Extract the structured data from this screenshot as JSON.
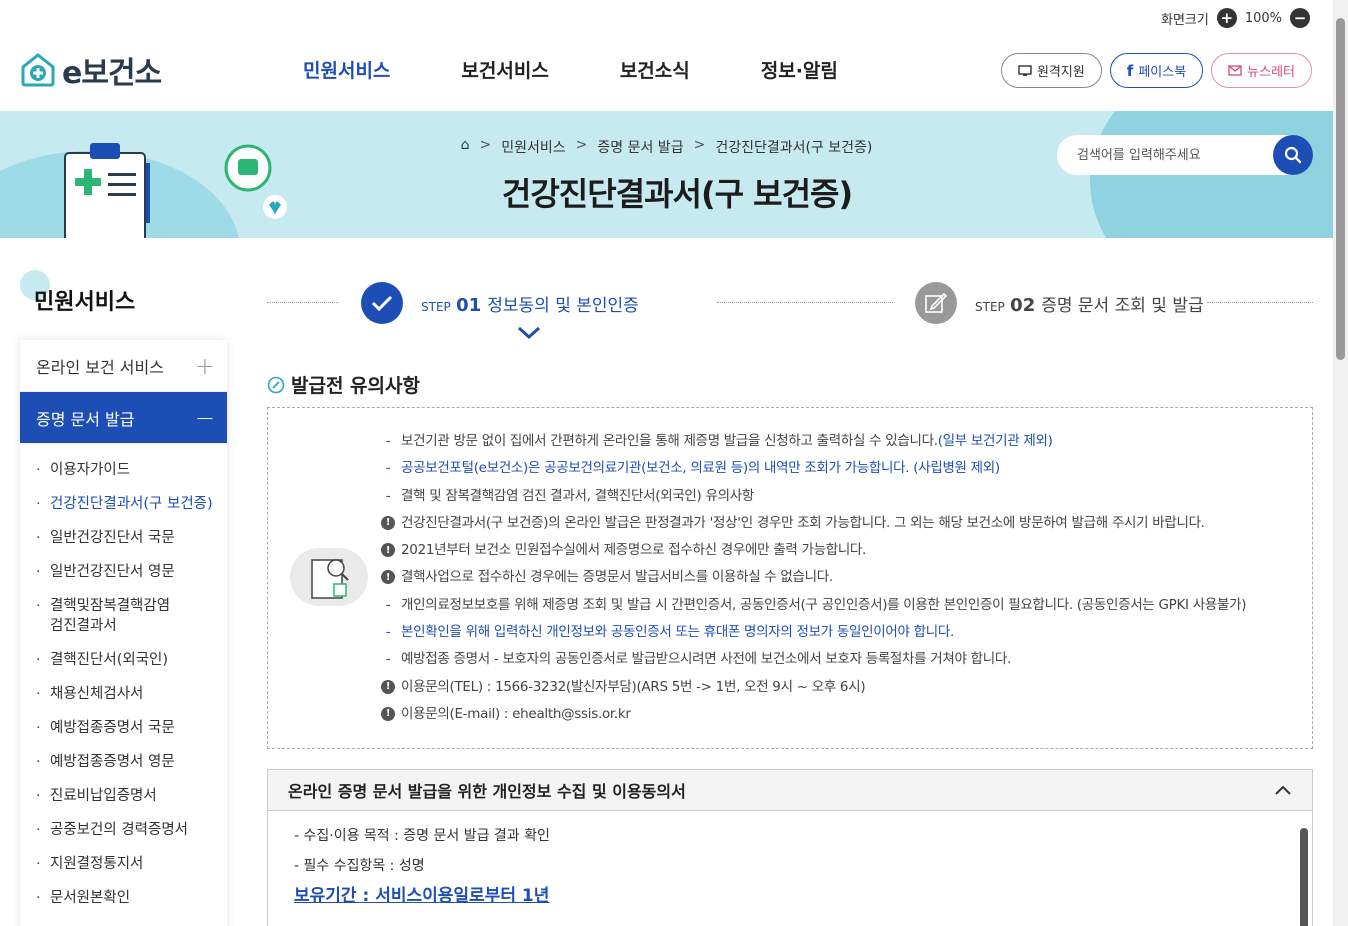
{
  "util": {
    "label": "화면크기",
    "zoom": "100%"
  },
  "brand": {
    "name": "e보건소"
  },
  "gnb": [
    "민원서비스",
    "보건서비스",
    "보건소식",
    "정보·알림"
  ],
  "header_buttons": {
    "remote": "원격지원",
    "facebook": "페이스북",
    "newsletter": "뉴스레터"
  },
  "breadcrumb": [
    "민원서비스",
    "증명 문서 발급",
    "건강진단결과서(구 보건증)"
  ],
  "page_title": "건강진단결과서(구 보건증)",
  "search": {
    "placeholder": "검색어를 입력해주세요"
  },
  "sidebar": {
    "title": "민원서비스",
    "categories": [
      {
        "label": "온라인 보건 서비스",
        "toggle": "+"
      },
      {
        "label": "증명 문서 발급",
        "toggle": "−"
      }
    ],
    "items": [
      "이용자가이드",
      "건강진단결과서(구 보건증)",
      "일반건강진단서 국문",
      "일반건강진단서 영문",
      "결핵및잠복결핵감염",
      "검진결과서",
      "결핵진단서(외국인)",
      "채용신체검사서",
      "예방접종증명서 국문",
      "예방접종증명서 영문",
      "진료비납입증명서",
      "공중보건의 경력증명서",
      "지원결정통지서",
      "문서원본확인"
    ]
  },
  "steps": [
    {
      "prefix": "STEP",
      "num": "01",
      "label": "정보동의 및 본인인증"
    },
    {
      "prefix": "STEP",
      "num": "02",
      "label": "증명 문서 조회 및 발급"
    }
  ],
  "notice": {
    "title": "발급전 유의사항",
    "items": [
      {
        "mark": "-",
        "text": "보건기관 방문 없이 집에서 간편하게 온라인을 통해 제증명 발급을 신청하고 출력하실 수 있습니다.",
        "tail": "(일부 보건기관 제외)",
        "style": "normal"
      },
      {
        "mark": "-",
        "text": "공공보건포털(e보건소)은 공공보건의료기관(보건소, 의료원 등)의 내역만 조회가 가능합니다. (사립병원 제외)",
        "tail": "",
        "style": "blue"
      },
      {
        "mark": "-",
        "text": "결핵 및 잠복결핵감염 검진 결과서, 결핵진단서(외국인) 유의사항",
        "tail": "",
        "style": "normal"
      },
      {
        "mark": "!",
        "text": "건강진단결과서(구 보건증)의 온라인 발급은 판정결과가 '정상'인 경우만 조회 가능합니다. 그 외는 해당 보건소에 방문하여 발급해 주시기 바랍니다.",
        "tail": "",
        "style": "normal"
      },
      {
        "mark": "!",
        "text": "2021년부터 보건소 민원접수실에서 제증명으로 접수하신 경우에만 출력 가능합니다.",
        "tail": "",
        "style": "normal"
      },
      {
        "mark": "!",
        "text": "결핵사업으로 접수하신 경우에는 증명문서 발급서비스를 이용하실 수 없습니다.",
        "tail": "",
        "style": "normal"
      },
      {
        "mark": "-",
        "text": "개인의료정보보호를 위해 제증명 조회 및 발급 시 간편인증서, 공동인증서(구 공인인증서)를 이용한 본인인증이 필요합니다. (공동인증서는 GPKI 사용불가)",
        "tail": "",
        "style": "normal"
      },
      {
        "mark": "-",
        "text": "본인확인을 위해 입력하신 개인정보와 공동인증서 또는 휴대폰 명의자의 정보가 동일인이어야 합니다.",
        "tail": "",
        "style": "blue"
      },
      {
        "mark": "-",
        "text": "예방접종 증명서 - 보호자의 공동인증서로 발급받으시려면 사전에 보건소에서 보호자 등록절차를 거쳐야 합니다.",
        "tail": "",
        "style": "normal"
      },
      {
        "mark": "!",
        "text": "이용문의(TEL) : 1566-3232(발신자부담)(ARS 5번 -> 1번, 오전 9시 ~ 오후 6시)",
        "tail": "",
        "style": "normal"
      },
      {
        "mark": "!",
        "text": "이용문의(E-mail) : ehealth@ssis.or.kr",
        "tail": "",
        "style": "normal"
      }
    ]
  },
  "consent": {
    "title": "온라인 증명 문서 발급을 위한 개인정보 수집 및 이용동의서",
    "lines": [
      "- 수집·이용 목적 : 증명 문서 발급 결과 확인",
      "- 필수 수집항목 : 성명"
    ],
    "retention": "보유기간 : 서비스이용일로부터 1년"
  },
  "colors": {
    "primary": "#1d4eb5",
    "banner": "#c7eaf0"
  }
}
